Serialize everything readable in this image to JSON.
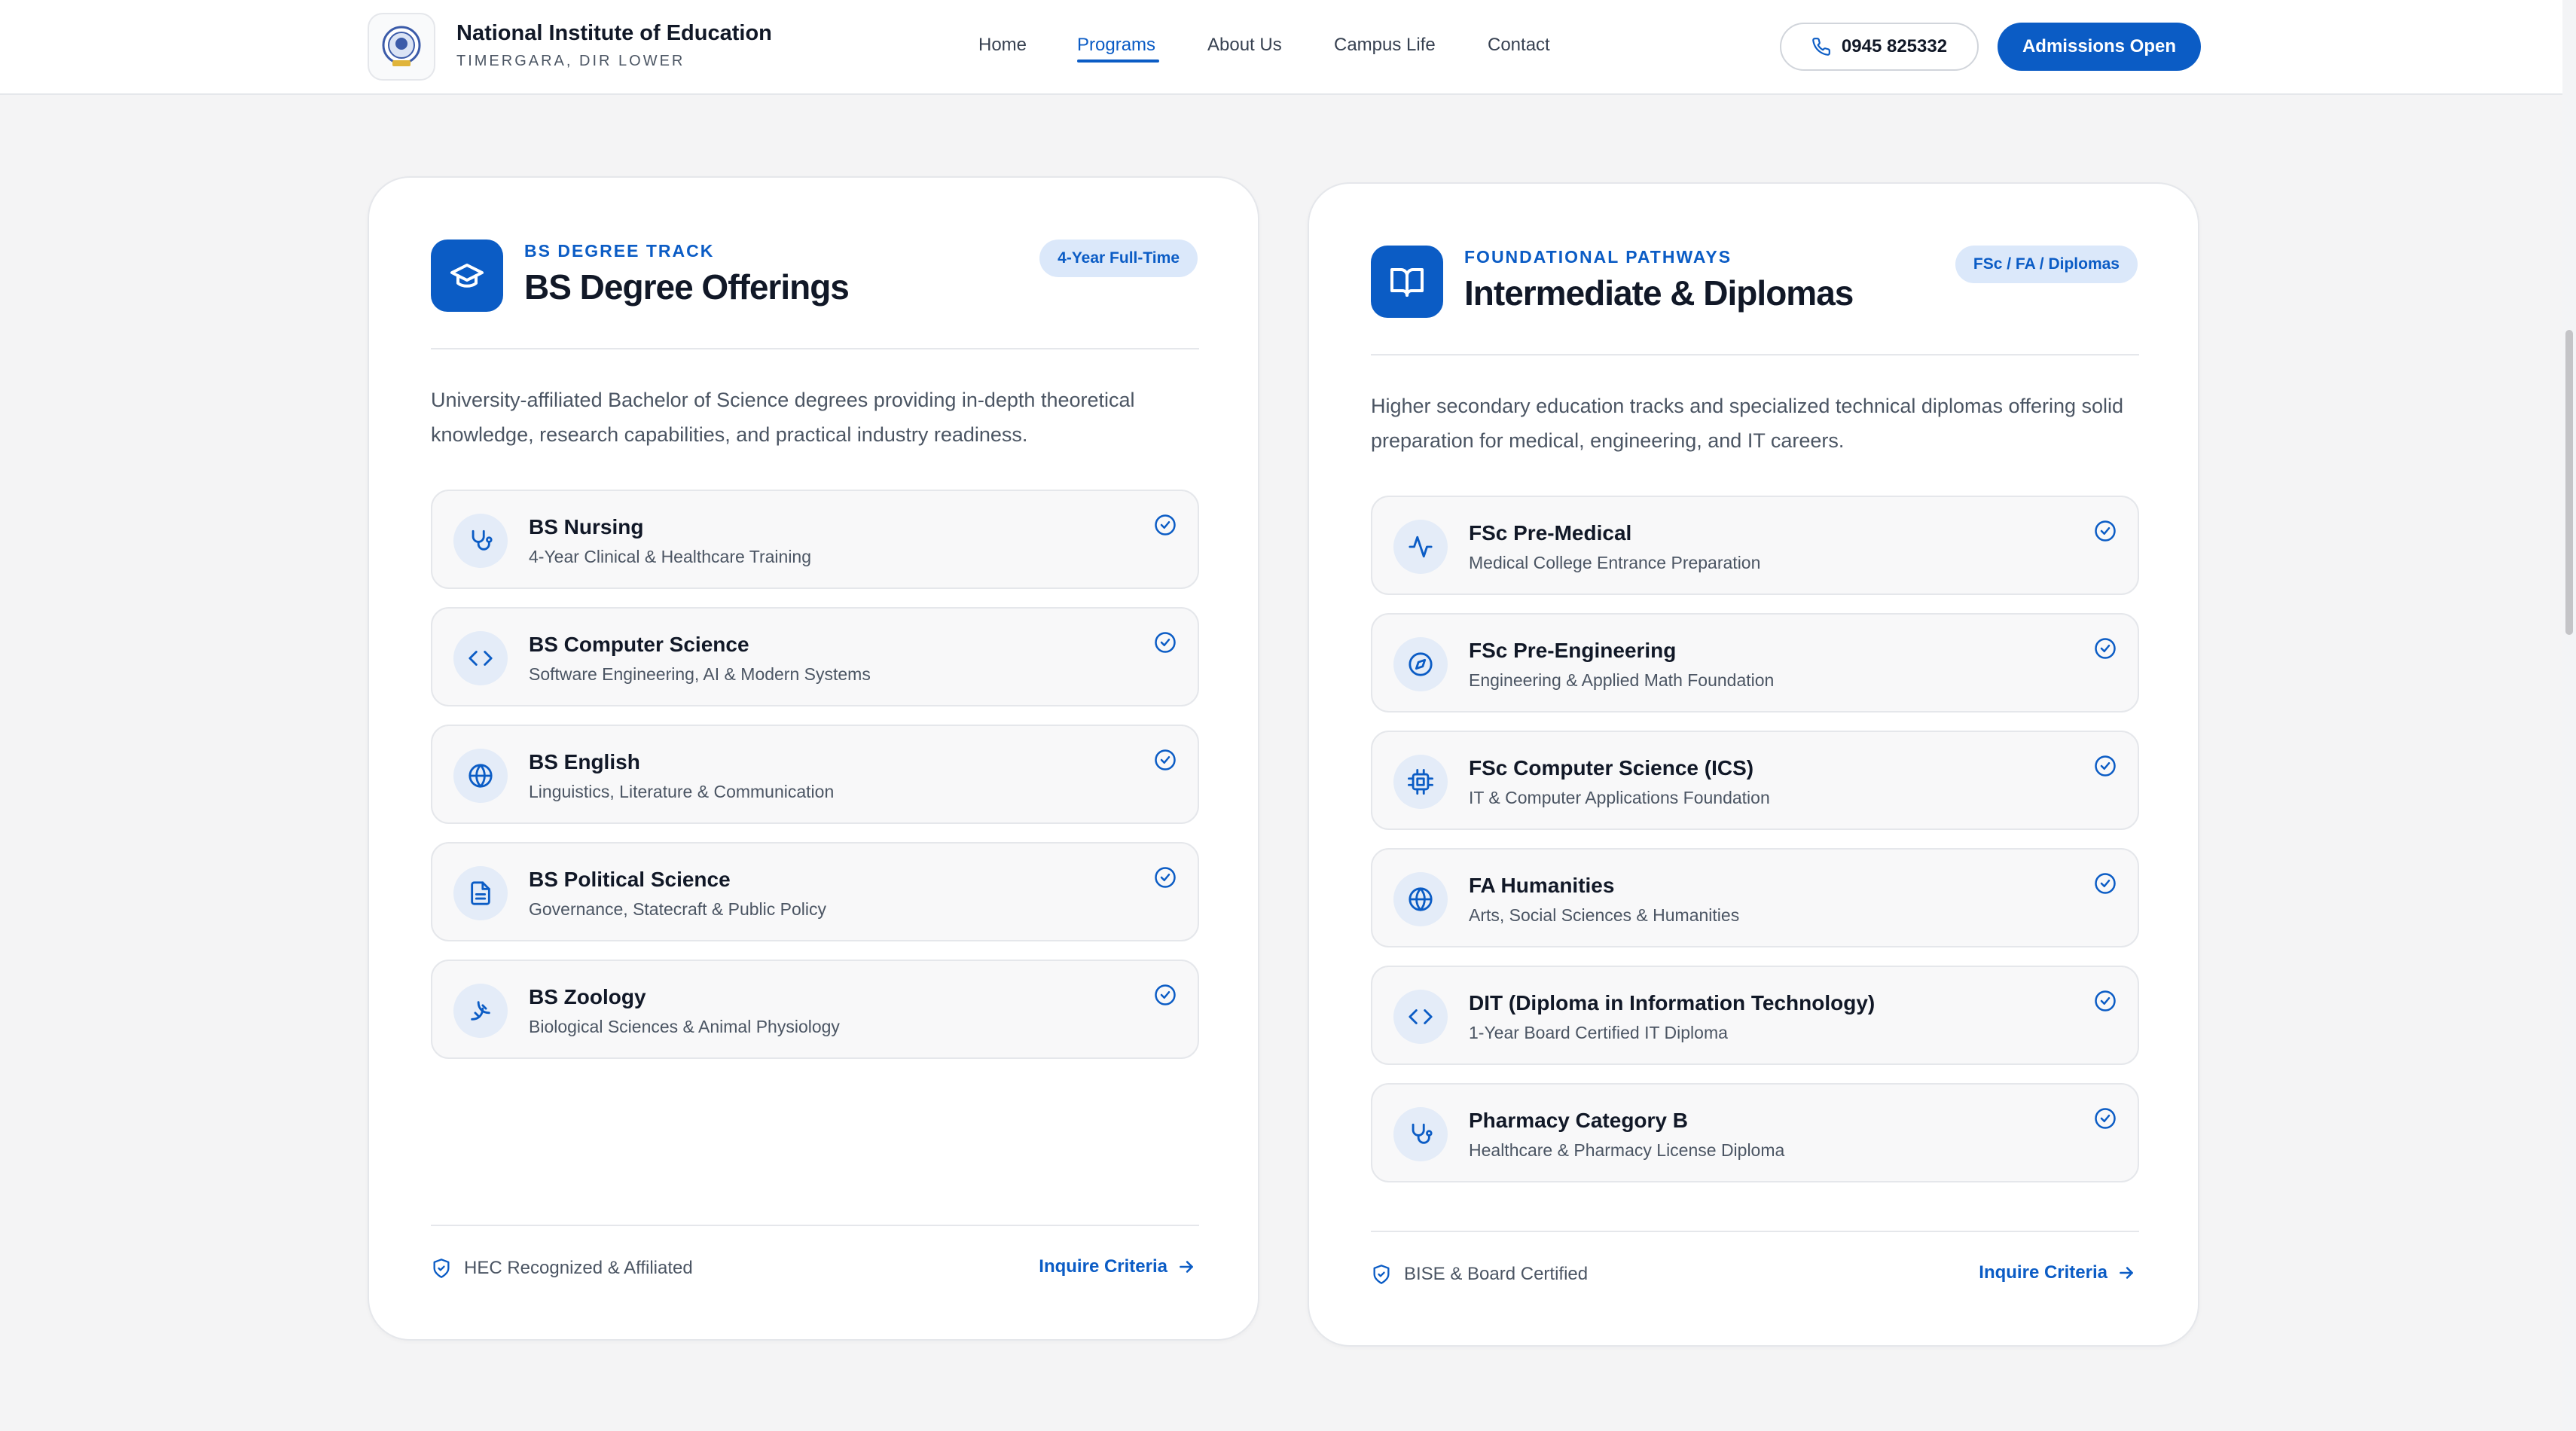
{
  "header": {
    "brand_title": "National Institute of Education",
    "brand_subtitle": "TIMERGARA, DIR LOWER",
    "nav": [
      {
        "label": "Home",
        "active": false
      },
      {
        "label": "Programs",
        "active": true
      },
      {
        "label": "About Us",
        "active": false
      },
      {
        "label": "Campus Life",
        "active": false
      },
      {
        "label": "Contact",
        "active": false
      }
    ],
    "phone": "0945 825332",
    "cta_label": "Admissions Open"
  },
  "bs_card": {
    "eyebrow": "BS DEGREE TRACK",
    "title": "BS Degree Offerings",
    "pill": "4-Year Full-Time",
    "description": "University-affiliated Bachelor of Science degrees providing in-depth theoretical knowledge, research capabilities, and practical industry readiness.",
    "items": [
      {
        "title": "BS Nursing",
        "subtitle": "4-Year Clinical & Healthcare Training",
        "icon": "stethoscope-icon"
      },
      {
        "title": "BS Computer Science",
        "subtitle": "Software Engineering, AI & Modern Systems",
        "icon": "code-icon"
      },
      {
        "title": "BS English",
        "subtitle": "Linguistics, Literature & Communication",
        "icon": "globe-icon"
      },
      {
        "title": "BS Political Science",
        "subtitle": "Governance, Statecraft & Public Policy",
        "icon": "document-icon"
      },
      {
        "title": "BS Zoology",
        "subtitle": "Biological Sciences & Animal Physiology",
        "icon": "dna-icon"
      }
    ],
    "footer_badge": "HEC Recognized & Affiliated",
    "footer_link": "Inquire Criteria"
  },
  "inter_card": {
    "eyebrow": "FOUNDATIONAL PATHWAYS",
    "title": "Intermediate & Diplomas",
    "pill": "FSc / FA / Diplomas",
    "description": "Higher secondary education tracks and specialized technical diplomas offering solid preparation for medical, engineering, and IT careers.",
    "items": [
      {
        "title": "FSc Pre-Medical",
        "subtitle": "Medical College Entrance Preparation",
        "icon": "pulse-icon"
      },
      {
        "title": "FSc Pre-Engineering",
        "subtitle": "Engineering & Applied Math Foundation",
        "icon": "compass-icon"
      },
      {
        "title": "FSc Computer Science (ICS)",
        "subtitle": "IT & Computer Applications Foundation",
        "icon": "cpu-icon"
      },
      {
        "title": "FA Humanities",
        "subtitle": "Arts, Social Sciences & Humanities",
        "icon": "globe-icon"
      },
      {
        "title": "DIT (Diploma in Information Technology)",
        "subtitle": "1-Year Board Certified IT Diploma",
        "icon": "code-icon"
      },
      {
        "title": "Pharmacy Category B",
        "subtitle": "Healthcare & Pharmacy License Diploma",
        "icon": "stethoscope-icon"
      }
    ],
    "footer_badge": "BISE & Board Certified",
    "footer_link": "Inquire Criteria"
  },
  "colors": {
    "accent": "#0b5cc5",
    "pill_bg": "#dbe8fa",
    "icon_bg": "#e4ecf8",
    "page_bg": "#f4f4f5"
  }
}
